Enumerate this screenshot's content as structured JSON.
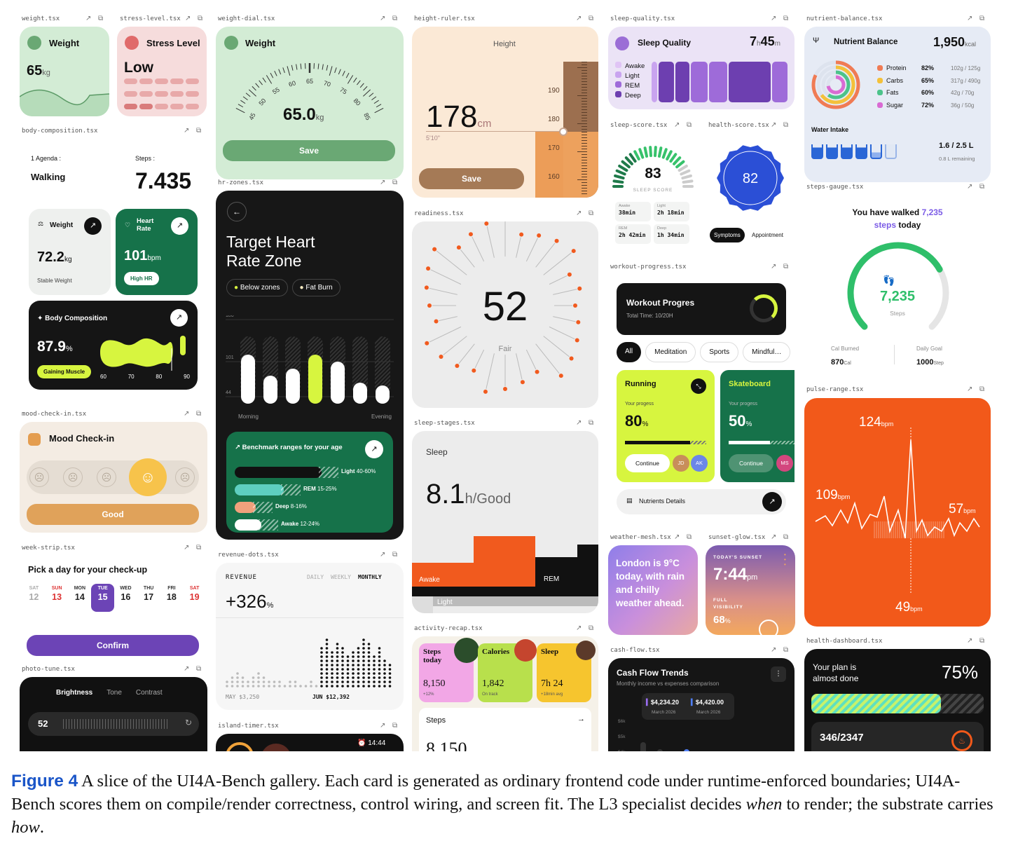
{
  "caption": {
    "figure": "Figure 4",
    "text_a": " A slice of the UI4A-Bench gallery. Each card is generated as ordinary frontend code under runtime-enforced boundaries; UI4A-Bench scores them on compile/render correctness, control wiring, and screen fit. The L3 specialist decides ",
    "when": "when",
    "text_b": " to render; the substrate carries ",
    "how": "how",
    "end": "."
  },
  "files": [
    "weight.tsx",
    "stress-level.tsx",
    "weight-dial.tsx",
    "height-ruler.tsx",
    "sleep-quality.tsx",
    "nutrient-balance.tsx",
    "body-composition.tsx",
    "hr-zones.tsx",
    "readiness.tsx",
    "sleep-score.tsx",
    "health-score.tsx",
    "steps-gauge.tsx",
    "mood-check-in.tsx",
    "workout-progress.tsx",
    "sleep-stages.tsx",
    "pulse-range.tsx",
    "week-strip.tsx",
    "revenue-dots.tsx",
    "weather-mesh.tsx",
    "sunset-glow.tsx",
    "activity-recap.tsx",
    "cash-flow.tsx",
    "health-dashboard.tsx",
    "photo-tune.tsx",
    "island-timer.tsx"
  ],
  "weight": {
    "title": "Weight",
    "value": "65",
    "unit": "kg"
  },
  "stress": {
    "title": "Stress Level",
    "value": "Low"
  },
  "dial": {
    "title": "Weight",
    "value": "65.0",
    "unit": "kg",
    "ticks": [
      "45",
      "50",
      "55",
      "60",
      "65",
      "70",
      "75",
      "80",
      "85"
    ],
    "save": "Save"
  },
  "height": {
    "title": "Height",
    "value": "178",
    "unit": "cm",
    "imperial": "5'10\"",
    "ticks": [
      "190",
      "180",
      "170",
      "160"
    ],
    "save": "Save"
  },
  "sleepq": {
    "title": "Sleep Quality",
    "hours": "7",
    "h": "h",
    "mins": "45",
    "m": "m",
    "legend": [
      "Awake",
      "Light",
      "REM",
      "Deep"
    ]
  },
  "nutrient": {
    "title": "Nutrient Balance",
    "kcal": "1,950",
    "kcal_unit": "kcal",
    "rows": [
      [
        "Protein",
        "82%",
        "102g / 125g"
      ],
      [
        "Carbs",
        "65%",
        "317g / 490g"
      ],
      [
        "Fats",
        "60%",
        "42g / 70g"
      ],
      [
        "Sugar",
        "72%",
        "36g / 50g"
      ]
    ],
    "water_title": "Water Intake",
    "water": "1.6 / 2.5 L",
    "remaining": "0.8 L remaining"
  },
  "body": {
    "agenda": "1 Agenda :",
    "walking": "Walking",
    "steps_lbl": "Steps :",
    "steps": "7.435",
    "weight_lbl": "Weight",
    "weight": "72.2",
    "weight_unit": "kg",
    "stable": "Stable Weight",
    "hr_lbl": "Heart Rate",
    "hr": "101",
    "hr_unit": "bpm",
    "high": "High HR",
    "comp_title": "Body Composition",
    "comp": "87.9",
    "comp_unit": "%",
    "gaining": "Gaining Muscle",
    "axis": [
      "60",
      "70",
      "80",
      "90"
    ]
  },
  "hr": {
    "title1": "Target Heart",
    "title2": "Rate Zone",
    "below": "Below zones",
    "fat": "Fat Burn",
    "y": [
      "186",
      "101",
      "44"
    ],
    "morning": "Morning",
    "evening": "Evening",
    "bench": "Benchmark ranges for your age",
    "ranges": [
      [
        "Light",
        "40-60%"
      ],
      [
        "REM",
        "15-25%"
      ],
      [
        "Deep",
        "8-16%"
      ],
      [
        "Awake",
        "12-24%"
      ]
    ]
  },
  "ready": {
    "value": "52",
    "label": "Fair"
  },
  "sscore": {
    "value": "83",
    "label": "SLEEP SCORE",
    "cells": [
      [
        "Awake",
        "38min"
      ],
      [
        "Light",
        "2h 18min"
      ],
      [
        "REM",
        "2h 42min"
      ],
      [
        "Deep",
        "1h 34min"
      ]
    ]
  },
  "hscore": {
    "value": "82",
    "symptoms": "Symptoms",
    "appointment": "Appointment"
  },
  "steps": {
    "l1": "You have walked ",
    "num": "7,235",
    "l2": "steps",
    "l3": " today",
    "value": "7,235",
    "unit": "Steps",
    "cal_lbl": "Cal Burned",
    "cal": "870",
    "cal_unit": "Cal",
    "goal_lbl": "Daily Goal",
    "goal": "1000",
    "goal_unit": "Step"
  },
  "mood": {
    "title": "Mood Check-in",
    "good": "Good"
  },
  "workout": {
    "title": "Workout Progres",
    "total": "Total Time: 10/20H",
    "tabs": [
      "All",
      "Meditation",
      "Sports",
      "Mindful…"
    ],
    "run": "Running",
    "skate": "Skateboard",
    "yp": "Your progess",
    "run_pct": "80",
    "skate_pct": "50",
    "pct": "%",
    "cont": "Continue",
    "a1": "JD",
    "a2": "AK",
    "a3": "MS",
    "details": "Nutrients Details"
  },
  "stages": {
    "title": "Sleep",
    "value": "8.1",
    "sub": "h/Good",
    "awake": "Awake",
    "rem": "REM",
    "light": "Light"
  },
  "pulse": {
    "max": "124",
    "mid": "109",
    "low": "57",
    "min": "49",
    "unit": "bpm"
  },
  "week": {
    "title": "Pick a day for your check-up",
    "days": [
      "SAT",
      "SUN",
      "MON",
      "TUE",
      "WED",
      "THU",
      "FRI",
      "SAT"
    ],
    "dates": [
      "12",
      "13",
      "14",
      "15",
      "16",
      "17",
      "18",
      "19"
    ],
    "confirm": "Confirm"
  },
  "revenue": {
    "title": "REVENUE",
    "tabs": [
      "DAILY",
      "WEEKLY",
      "MONTHLY"
    ],
    "value": "+326",
    "unit": "%",
    "may": "MAY $3,250",
    "jun": "JUN $12,392"
  },
  "weather": {
    "text": "London is 9°C today, with rain and chilly weather ahead."
  },
  "sunset": {
    "lbl": "TODAY'S SUNSET",
    "time": "7:44",
    "pm": "pm",
    "vis": "FULL VISIBILITY",
    "pct": "68",
    "unit": "%"
  },
  "recap": {
    "t1": "Steps today",
    "v1": "8,150",
    "s1": "+12%",
    "t2": "Calories",
    "v2": "1,842",
    "s2": "On track",
    "t3": "Sleep",
    "v3": "7h 24",
    "s3": "+18min avg",
    "steps_lbl": "Steps",
    "steps_val": "8,150"
  },
  "cash": {
    "title": "Cash Flow Trends",
    "sub": "Monthly income vs expenses comparison",
    "v1": "$4,234.20",
    "d1": "March 2026",
    "v2": "$4,420.00",
    "d2": "March 2026",
    "y": [
      "$6k",
      "$5k",
      "$4k",
      "$3k"
    ]
  },
  "dash": {
    "l1": "Your plan is",
    "l2": "almost done",
    "pct": "75%",
    "count": "346/2347"
  },
  "photo": {
    "tabs": [
      "Brightness",
      "Tone",
      "Contrast"
    ],
    "value": "52"
  },
  "timer": {
    "time": "14:44"
  }
}
